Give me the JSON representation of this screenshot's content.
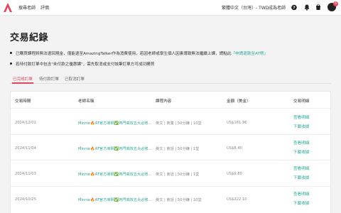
{
  "nav": {
    "find_teacher": "搜尋老師",
    "reviews": "評價",
    "lang": "繁體中文（台灣）- TWD",
    "become_teacher": "成為老師",
    "notification_count": "6"
  },
  "page": {
    "title": "交易紀錄",
    "note1_text": "已購買課程將無法退回現金，僅能退至AmazingTalker作為消費使用，若因老師或學生個人因素導致無法繼續上課，請點此",
    "note1_link": "「申請退款至AT幣」",
    "note2_text": "若待付款訂單中包含\"未付款之優惠課\"，需先取消或支付該筆訂單方可成功購買"
  },
  "tabs": [
    "已完成訂單",
    "待付款訂單",
    "已取消訂單"
  ],
  "table": {
    "headers": [
      "交易時間",
      "老師名稱",
      "課程內容",
      "金額（美金）",
      "交易明細"
    ],
    "rows": [
      {
        "date": "2024/12/01",
        "teacher": "Minnie🔥AT官方導師✅熱門高效五大必修...",
        "content": "英文 | 商業 | 50分鐘 | 10堂",
        "amount": "US$181.96",
        "actions": [
          "查看明細",
          "下載收據"
        ]
      },
      {
        "date": "2024/11/04",
        "teacher": "Minnie🔥AT官方導師✅熱門高效五大必修...",
        "content": "英文 | 會話 | 50分鐘 | 1堂",
        "amount": "US$8.40",
        "actions": [
          "查看明細",
          "下載收據"
        ]
      },
      {
        "date": "2024/11/03",
        "teacher": "Minnie🔥AT官方導師✅熱門高效五大必修...",
        "content": "英文 | 會話 | 50分鐘 | 1堂",
        "amount": "US$9.80",
        "actions": [
          "查看明細",
          "下載收據"
        ]
      },
      {
        "date": "2024/10/25",
        "teacher": "Minnie🔥AT官方導師✅熱門高效五大必修...",
        "content": "英文 | 會話 | 50分鐘 | 10堂",
        "amount": "US$222.10",
        "actions": [
          "查看明細",
          "下載收據"
        ]
      }
    ]
  },
  "colors": {
    "brand": "#e6455a",
    "link": "#2aa795"
  },
  "icons": [
    "logo-icon",
    "help-icon",
    "bell-icon",
    "cart-icon",
    "avatar"
  ]
}
